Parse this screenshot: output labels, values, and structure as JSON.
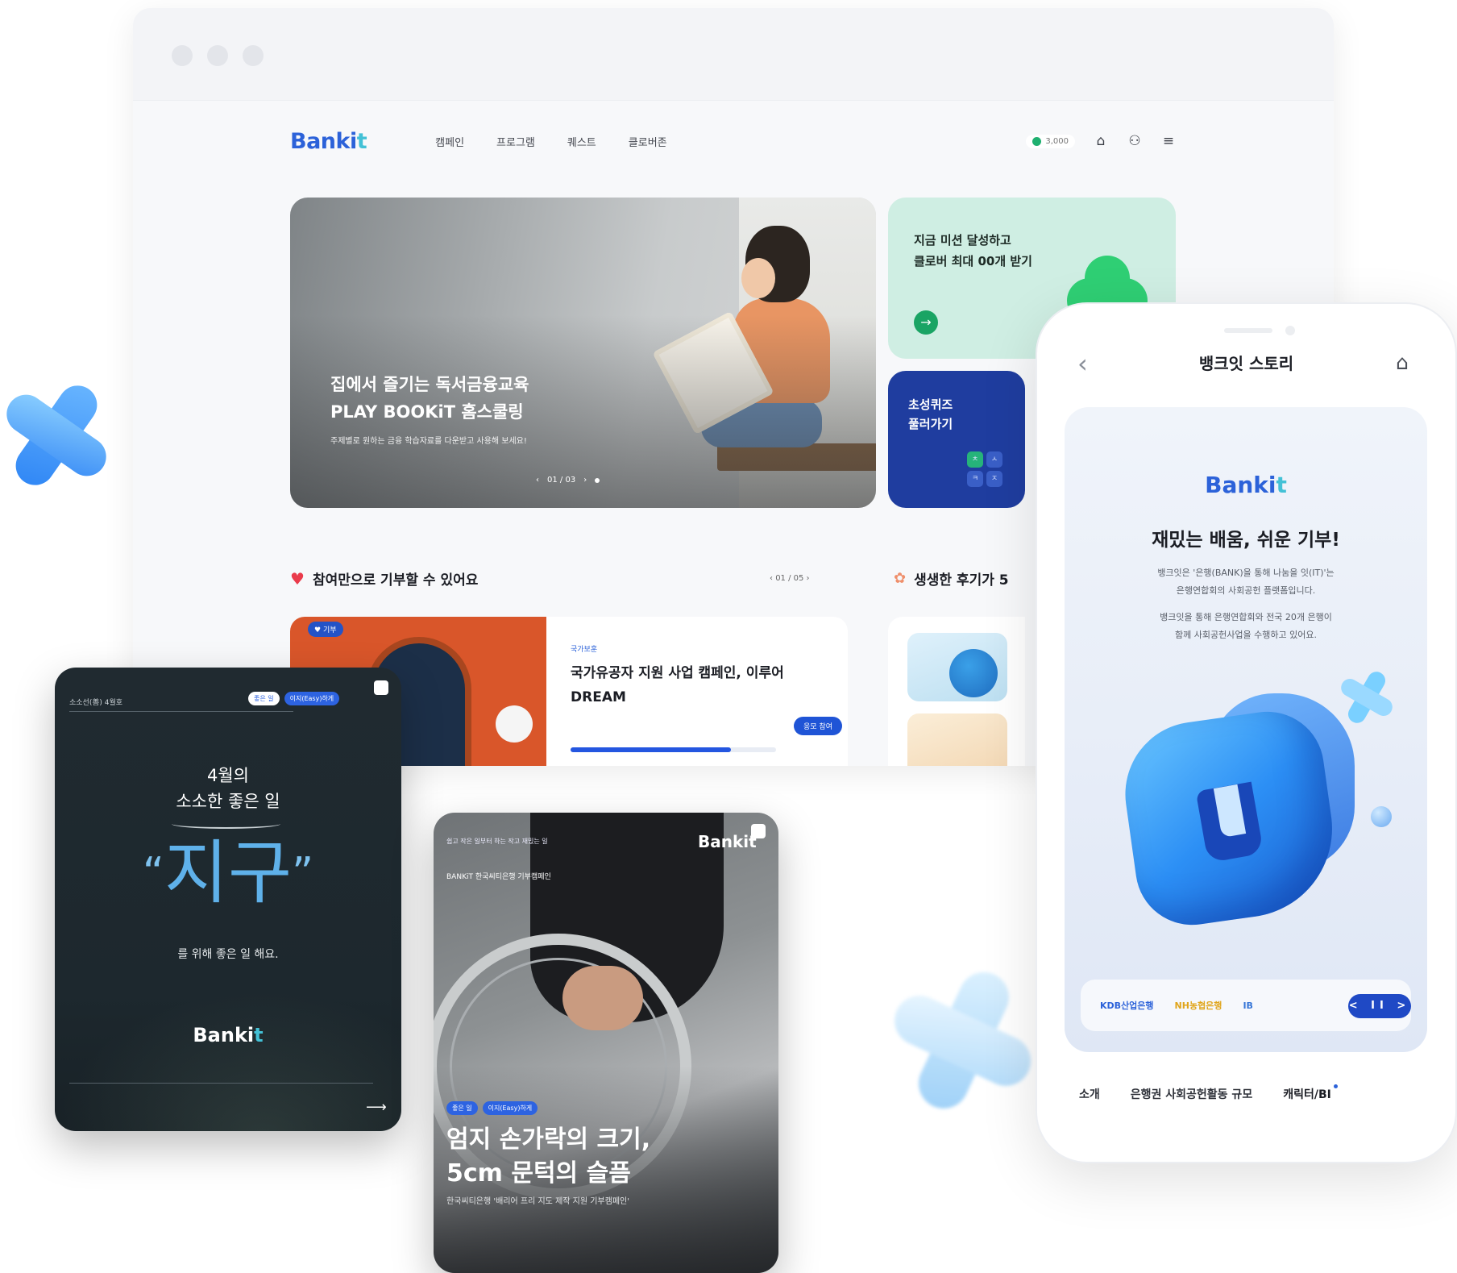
{
  "browser": {
    "nav": {
      "logo": "Banki",
      "logo_plus": "t",
      "items": [
        "캠페인",
        "프로그램",
        "퀘스트",
        "클로버존"
      ],
      "points": "3,000"
    },
    "hero": {
      "title": "집에서 즐기는 독서금융교육\nPLAY BOOKiT 홈스쿨링",
      "subtitle": "주제별로 원하는 금융 학습자료를 다운받고 사용해 보세요!",
      "pager": "01 / 03"
    },
    "mission": {
      "text": "지금 미션 달성하고\n클로버 최대 00개 받기"
    },
    "quiz": {
      "text": "초성퀴즈\n풀러가기",
      "letters": [
        "ㅊ",
        "ㅅ",
        "ㅋ",
        "ㅈ"
      ]
    },
    "section_donate": {
      "title": "참여만으로 기부할 수 있어요",
      "pager": "01 / 05"
    },
    "section_review": {
      "title": "생생한 후기가 5"
    },
    "campaign": {
      "tag": "기부",
      "category": "국가보훈",
      "title": "국가유공자 지원 사업 캠페인, 이루어\nDREAM",
      "bubble": "응모 참여",
      "progress": 0.78
    }
  },
  "card_dark": {
    "top": "소소선(善) 4월호",
    "chip1": "좋은 일",
    "chip2": "이지(Easy)하게",
    "month": "4월의\n소소한 좋은 일",
    "big": "지구",
    "open_quote": "“",
    "close_quote": "”",
    "sub": "를 위해 좋은 일 해요.",
    "logo": "Banki",
    "logo_plus": "t"
  },
  "card_photo": {
    "top": "쉽고 작은 일부터 하는 작고 재밌는 일",
    "sub": "BANKiT 한국씨티은행 기부캠페인",
    "logo": "Banki",
    "logo_plus": "t",
    "chip1": "좋은 일",
    "chip2": "이지(Easy)하게",
    "title": "엄지 손가락의 크기,\n5cm 문턱의 슬픔",
    "desc": "한국씨티은행 '배리어 프리 지도 제작 지원 기부캠페인'"
  },
  "phone": {
    "title": "뱅크잇 스토리",
    "logo": "Banki",
    "logo_plus": "t",
    "headline": "재밌는 배움, 쉬운 기부!",
    "desc1": "뱅크잇은 '은행(BANK)을 통해 나눔을 잇(IT)'는\n은행연합회의 사회공헌 플랫폼입니다.",
    "desc2": "뱅크잇을 통해 은행연합회와 전국 20개 은행이\n함께 사회공헌사업을 수행하고 있어요.",
    "banks": [
      "KDB산업은행",
      "NH농협은행",
      "IB"
    ],
    "control": "< II >",
    "tabs": [
      "소개",
      "은행권 사회공헌활동 규모",
      "캐릭터/BI"
    ]
  },
  "colors": {
    "brand_blue": "#2c62d9",
    "brand_cyan": "#43c1d6",
    "heart_red": "#ea3b4b",
    "clover_green": "#2fcf74",
    "quiz_navy": "#1f3d9f"
  }
}
